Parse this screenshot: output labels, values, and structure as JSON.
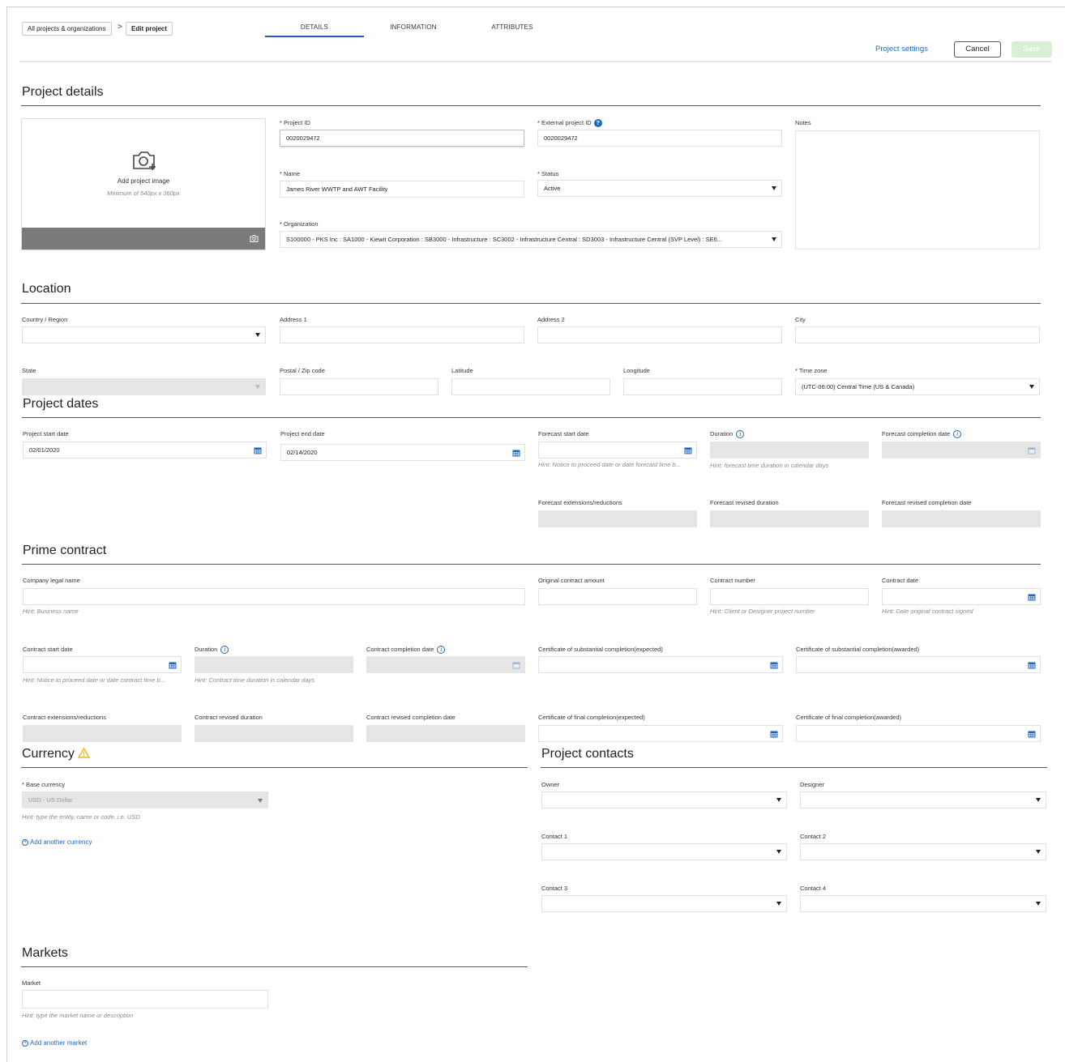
{
  "breadcrumb": {
    "root": "All projects & organizations",
    "current": "Edit project"
  },
  "tabs": [
    "DETAILS",
    "INFORMATION",
    "ATTRIBUTES"
  ],
  "toolbar": {
    "settings": "Project settings",
    "cancel": "Cancel",
    "save": "Save"
  },
  "details": {
    "title": "Project details",
    "image_title": "Add project image",
    "image_hint": "Minimum of 540px x 360px",
    "project_id_label": "* Project ID",
    "project_id_value": "0020029472",
    "external_id_label": "* External project ID",
    "external_id_value": "0020029472",
    "notes_label": "Notes",
    "name_label": "* Name",
    "name_value": "James River WWTP and AWT Facility",
    "status_label": "* Status",
    "status_value": "Active",
    "org_label": "* Organization",
    "org_value": "S100000 - PKS Inc : SA1000 - Kiewit Corporation : SB3000 - Infrastructure : SC3002 - Infrastructure Central : SD3003 - Infrastructure Central (SVP Level) : SE6..."
  },
  "location": {
    "title": "Location",
    "country_label": "Country / Region",
    "address1_label": "Address 1",
    "address2_label": "Address 2",
    "city_label": "City",
    "state_label": "State",
    "postal_label": "Postal / Zip code",
    "latitude_label": "Latitude",
    "longitude_label": "Longitude",
    "timezone_label": "* Time zone",
    "timezone_value": "(UTC-06:00) Central Time (US & Canada)"
  },
  "dates": {
    "title": "Project dates",
    "start_label": "Project start date",
    "start_value": "02/01/2020",
    "end_label": "Project end date",
    "end_value": "02/14/2020",
    "forecast_start_label": "Forecast start date",
    "forecast_start_hint": "Hint: Notice to proceed date or date forecast time b...",
    "duration_label": "Duration",
    "duration_hint": "Hint: forecast time duration in calendar days",
    "forecast_completion_label": "Forecast completion date",
    "ext_label": "Forecast extensions/reductions",
    "rev_duration_label": "Forecast revised duration",
    "rev_completion_label": "Forecast revised completion date"
  },
  "prime": {
    "title": "Prime contract",
    "legal_label": "Company legal name",
    "legal_hint": "Hint: Business name",
    "amount_label": "Original contract amount",
    "number_label": "Contract number",
    "number_hint": "Hint: Client or Designer project number",
    "date_label": "Contract date",
    "date_hint": "Hint: Date original contract signed",
    "start_label": "Contract start date",
    "start_hint": "Hint: Notice to proceed date or date contract time b...",
    "duration_label": "Duration",
    "duration_hint": "Hint: Contract time duration in calendar days",
    "completion_label": "Contract completion date",
    "sub_expected_label": "Certificate of substantial completion(expected)",
    "sub_awarded_label": "Certificate of substantial completion(awarded)",
    "ext_label": "Contract extensions/reductions",
    "rev_duration_label": "Contract revised duration",
    "rev_completion_label": "Contract revised completion date",
    "final_expected_label": "Certificate of final completion(expected)",
    "final_awarded_label": "Certificate of final completion(awarded)"
  },
  "currency": {
    "title": "Currency",
    "base_label": "* Base currency",
    "base_value": "USD - US Dollar",
    "base_hint": "Hint: type the entity, name or code. i.e. USD",
    "add_label": "Add another currency",
    "warning_color": "#f2b705"
  },
  "contacts": {
    "title": "Project contacts",
    "owner_label": "Owner",
    "designer_label": "Designer",
    "contact1_label": "Contact 1",
    "contact2_label": "Contact 2",
    "contact3_label": "Contact 3",
    "contact4_label": "Contact 4"
  },
  "markets": {
    "title": "Markets",
    "market_label": "Market",
    "market_hint": "Hint: type the market name or description",
    "add_label": "Add another market"
  },
  "colors": {
    "accent": "#1e67c0",
    "save_disabled": "#d8f0d4",
    "disabled_field": "#e5e5e5"
  }
}
